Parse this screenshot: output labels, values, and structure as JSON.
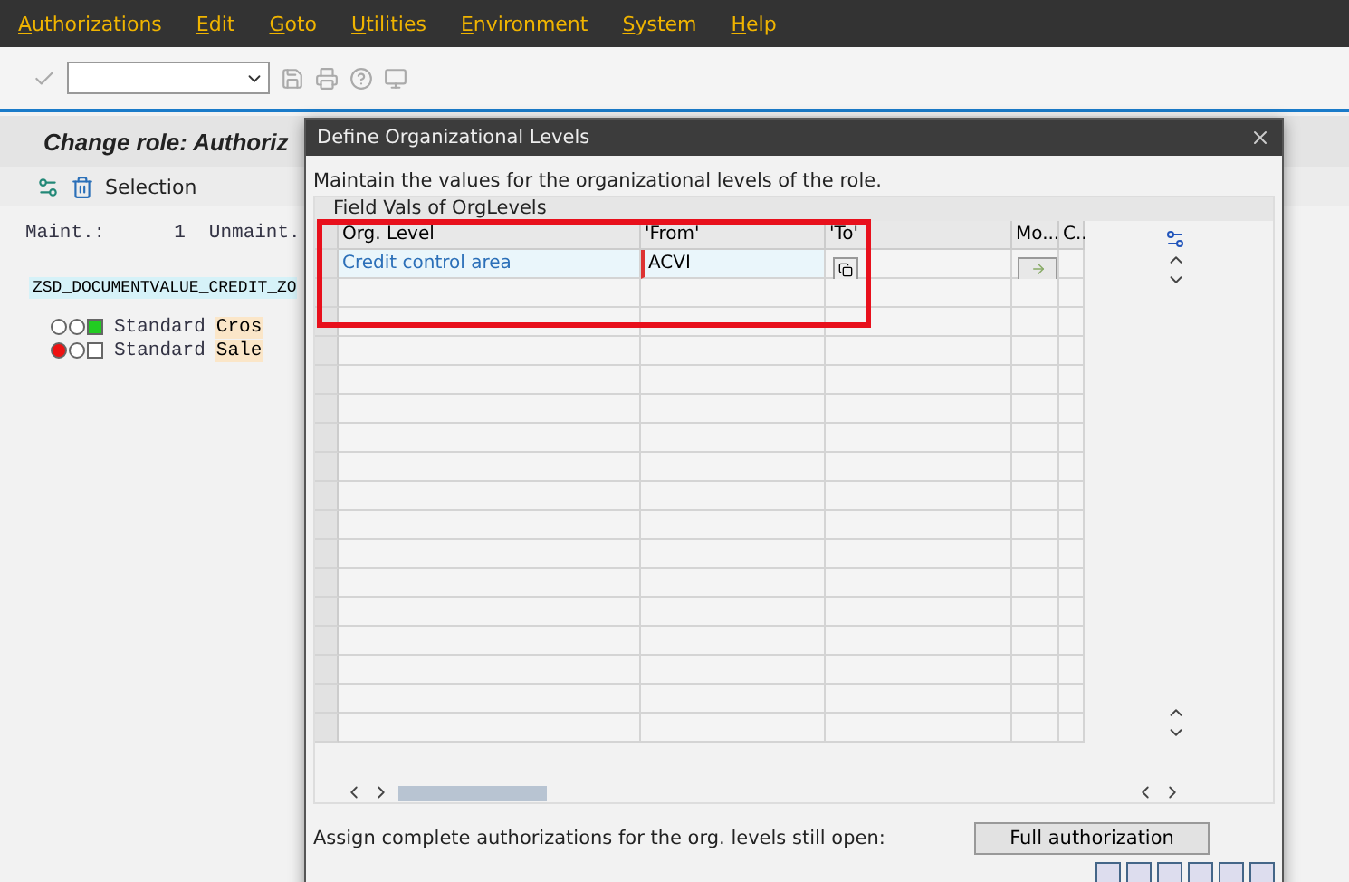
{
  "menu_bar": {
    "items": [
      "Authorizations",
      "Edit",
      "Goto",
      "Utilities",
      "Environment",
      "System",
      "Help"
    ]
  },
  "screen": {
    "title": "Change role: Authoriz",
    "selection_button": "Selection",
    "summary": {
      "maint_label": "Maint.:",
      "maint_count": "1",
      "unmaint_label": "Unmaint."
    },
    "role": "ZSD_DOCUMENTVALUE_CREDIT_ZO",
    "tree": [
      {
        "lights": [
          {
            "on": false
          },
          {
            "on": false
          },
          {
            "on": true,
            "color": "#22cc22"
          }
        ],
        "label": "Standard",
        "object": "Cros"
      },
      {
        "lights": [
          {
            "on": true,
            "color": "#ee1111"
          },
          {
            "on": false
          },
          {
            "on": false
          }
        ],
        "label": "Standard",
        "object": "Sale"
      }
    ]
  },
  "dialog": {
    "title": "Define Organizational Levels",
    "instruction": "Maintain the values for the organizational levels of the role.",
    "group_title": "Field Vals of OrgLevels",
    "columns": [
      "Org. Level",
      "'From'",
      "'To'",
      "Mo...",
      "C.."
    ],
    "rows": [
      {
        "org_level": "Credit control area",
        "from": "ACVI"
      }
    ],
    "footer_text": "Assign complete authorizations for the org. levels still open:",
    "full_button": "Full authorization"
  }
}
